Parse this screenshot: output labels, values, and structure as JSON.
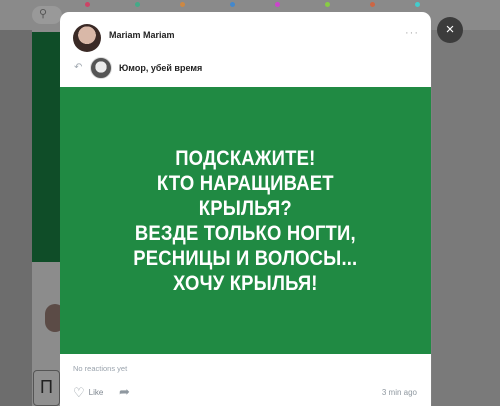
{
  "background": {
    "search_icon": "search-icon",
    "partial_text": "П"
  },
  "post": {
    "author": "Mariam Mariam",
    "more_icon": "···",
    "repost_source": "Юмор, убей время",
    "image_text_lines": [
      "ПОДСКАЖИТЕ!",
      "КТО НАРАЩИВАЕТ",
      "КРЫЛЬЯ?",
      "ВЕЗДЕ ТОЛЬКО НОГТИ,",
      "РЕСНИЦЫ И ВОЛОСЫ...",
      "ХОЧУ КРЫЛЬЯ!"
    ],
    "image_bg_color": "#208a43",
    "reactions": "No reactions yet",
    "like_label": "Like",
    "time": "3 min ago"
  },
  "close_icon": "×"
}
